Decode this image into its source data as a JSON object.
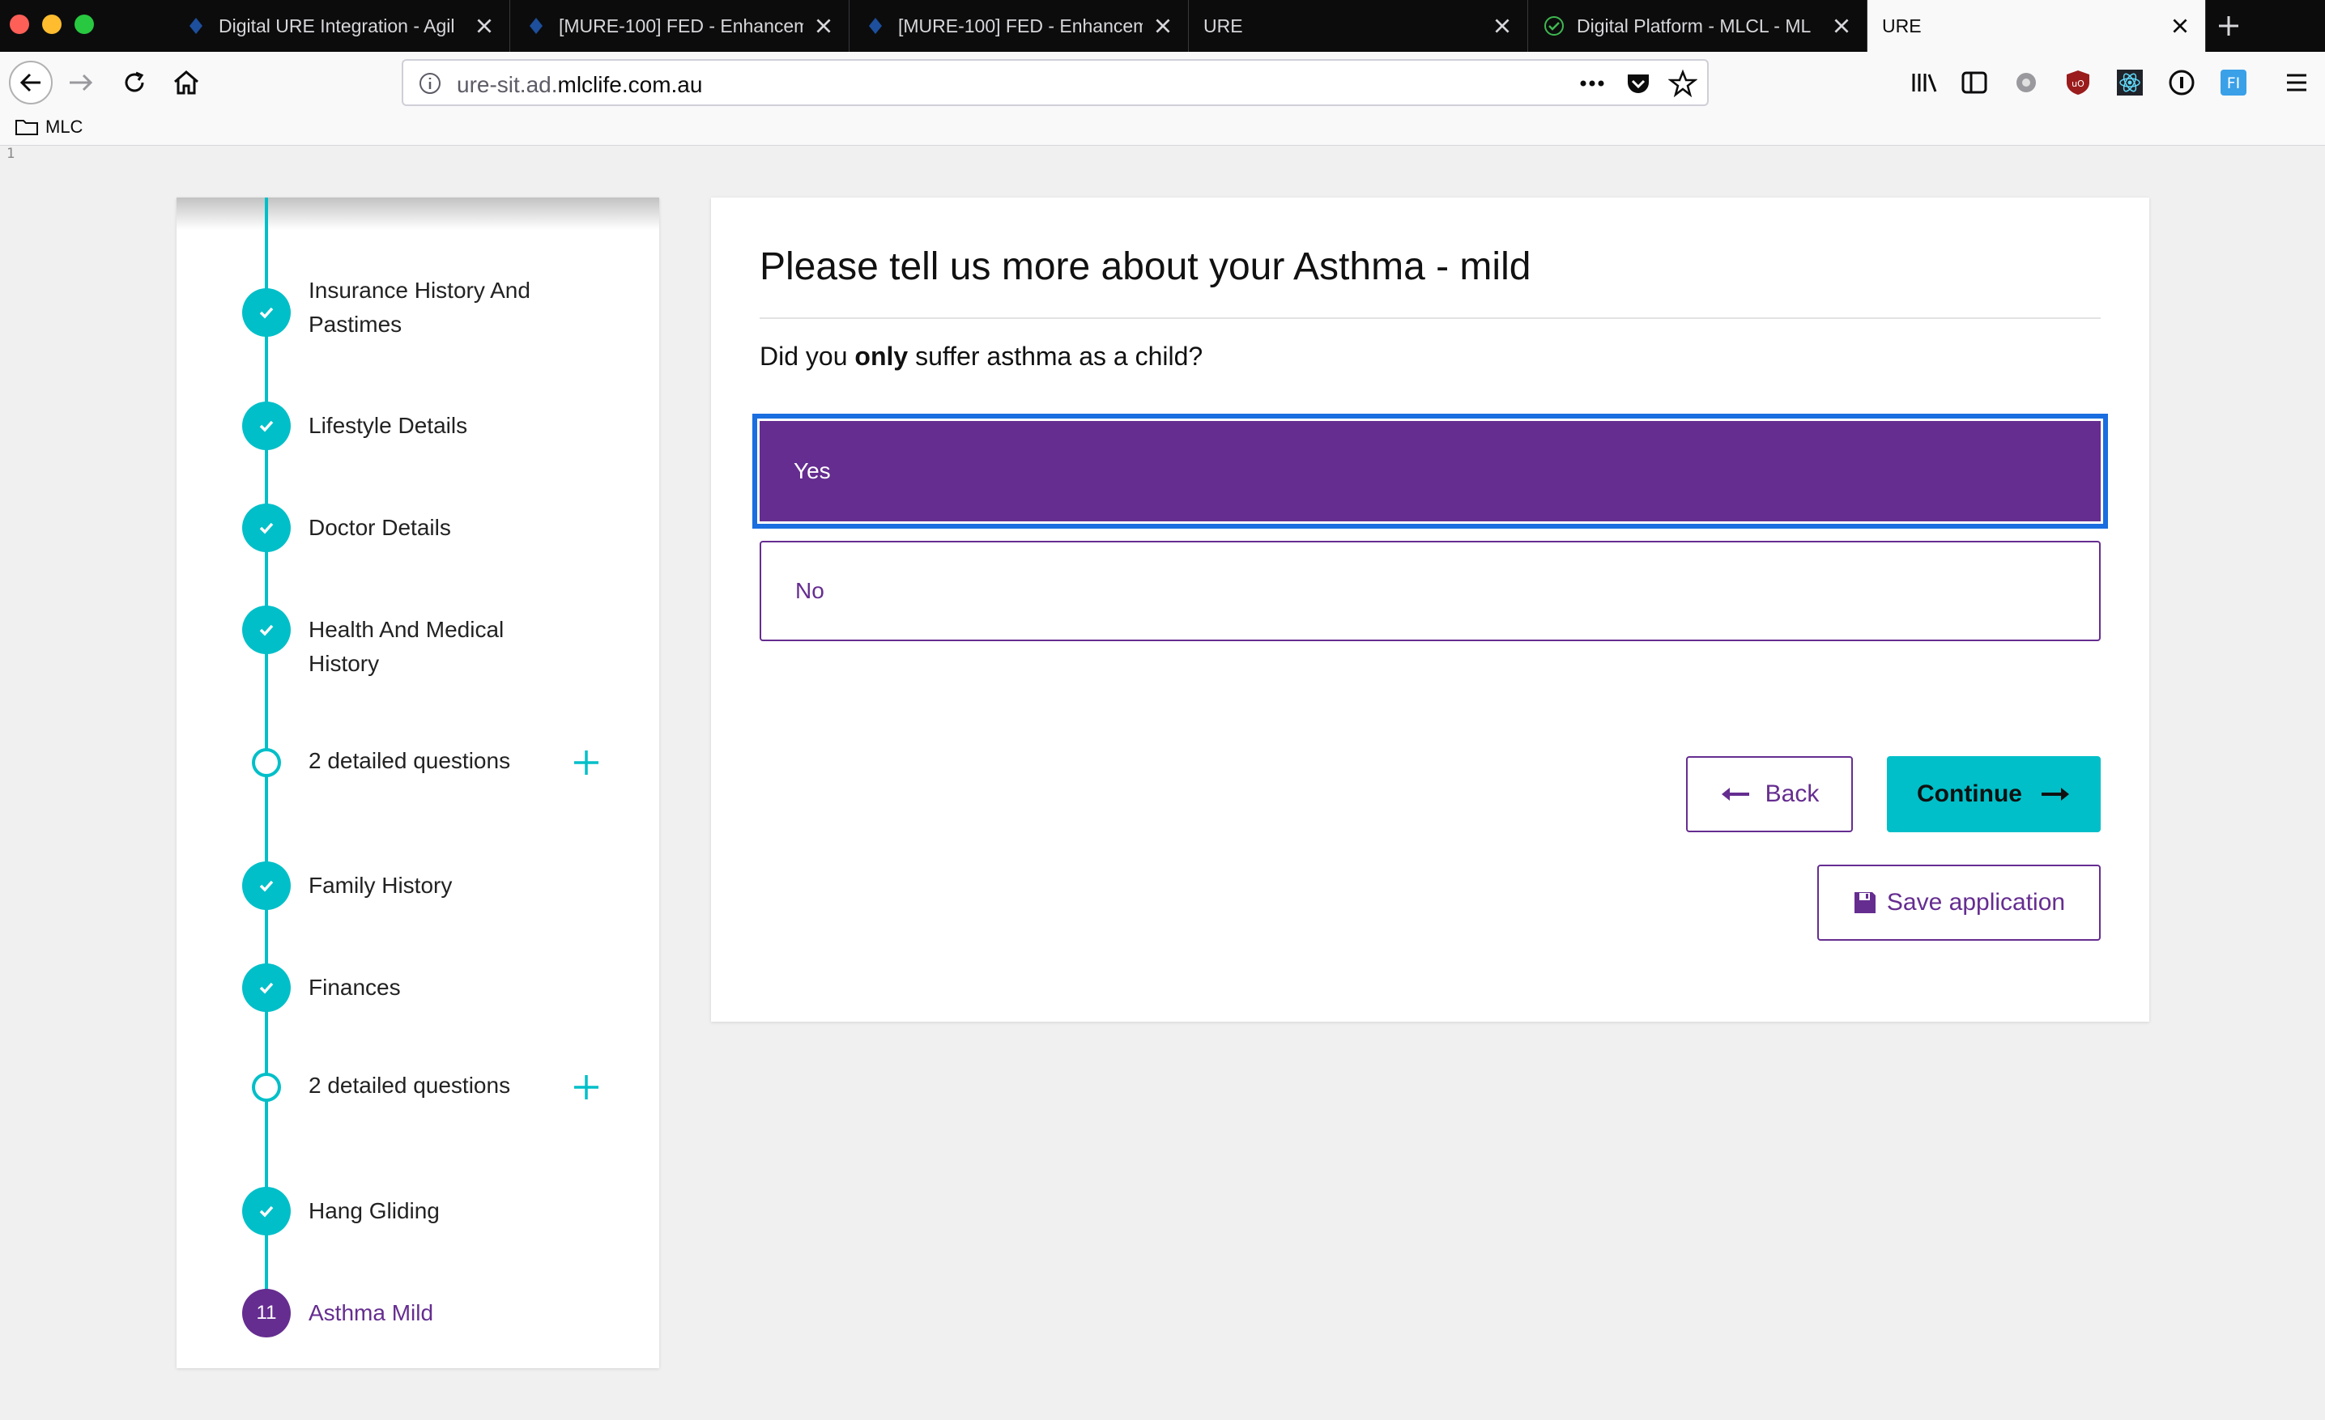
{
  "browser": {
    "tabs": [
      {
        "title": "Digital URE Integration - Agil",
        "active": false
      },
      {
        "title": "[MURE-100] FED - Enhancem",
        "active": false
      },
      {
        "title": "[MURE-100] FED - Enhancem",
        "active": false
      },
      {
        "title": "URE",
        "active": false
      },
      {
        "title": "Digital Platform - MLCL - ML",
        "active": false
      },
      {
        "title": "URE",
        "active": true
      }
    ],
    "url": {
      "prefix": "ure-sit.ad.",
      "domain": "mlclife.com.au"
    },
    "bookmarks": [
      {
        "label": "MLC"
      }
    ],
    "line_number": "1"
  },
  "progress": {
    "steps": [
      {
        "label": "Insurance History And Pastimes",
        "state": "done"
      },
      {
        "label": "Lifestyle Details",
        "state": "done"
      },
      {
        "label": "Doctor Details",
        "state": "done"
      },
      {
        "label": "Health And Medical History",
        "state": "done"
      },
      {
        "label": "2 detailed questions",
        "state": "open"
      },
      {
        "label": "Family History",
        "state": "done"
      },
      {
        "label": "Finances",
        "state": "done"
      },
      {
        "label": "2 detailed questions",
        "state": "open"
      },
      {
        "label": "Hang Gliding",
        "state": "done"
      },
      {
        "label": "Asthma Mild",
        "state": "current",
        "number": "11"
      }
    ]
  },
  "form": {
    "title": "Please tell us more about your Asthma - mild",
    "question": {
      "before": "Did you ",
      "emphasis": "only",
      "after": " suffer asthma as a child?"
    },
    "options": [
      {
        "label": "Yes",
        "selected": true
      },
      {
        "label": "No",
        "selected": false
      }
    ],
    "buttons": {
      "back": "Back",
      "continue": "Continue",
      "save": "Save application"
    }
  },
  "colors": {
    "accent_teal": "#00bfc8",
    "brand_purple": "#652d90",
    "focus_blue": "#1a6ee0"
  }
}
